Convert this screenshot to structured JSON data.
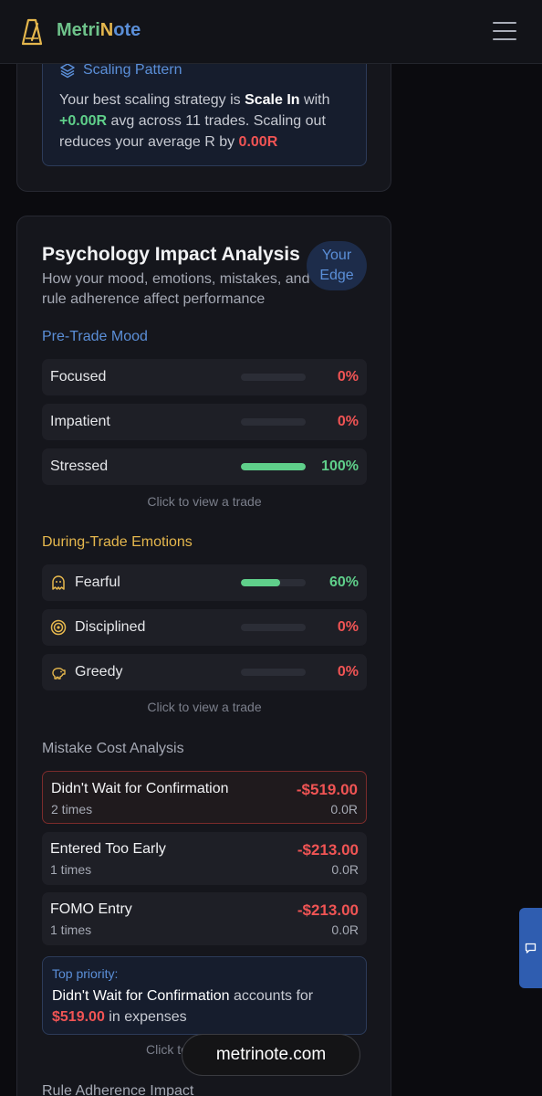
{
  "header": {
    "brand_part1": "Metri",
    "brand_part2": "N",
    "brand_part3": "ote",
    "logo_icon": "metronome-icon",
    "menu_icon": "hamburger-icon"
  },
  "scaling": {
    "title": "Scaling Pattern",
    "icon": "layers-icon",
    "text_1": "Your best scaling strategy is ",
    "strategy": "Scale In",
    "text_2": " with ",
    "avg_r": "+0.00R",
    "text_3": " avg across 11 trades. Scaling out reduces your average R by ",
    "reduce_r": "0.00R"
  },
  "psychology": {
    "title": "Psychology Impact Analysis",
    "subtitle": "How your mood, emotions, mistakes, and rule adherence affect performance",
    "badge": "Your Edge",
    "pre_trade_title": "Pre-Trade Mood",
    "moods": [
      {
        "label": "Focused",
        "pct": "0%",
        "value": 0
      },
      {
        "label": "Impatient",
        "pct": "0%",
        "value": 0
      },
      {
        "label": "Stressed",
        "pct": "100%",
        "value": 100
      }
    ],
    "hint": "Click to view a trade",
    "emotions_title": "During-Trade Emotions",
    "emotions": [
      {
        "label": "Fearful",
        "pct": "60%",
        "value": 60,
        "icon": "ghost-icon"
      },
      {
        "label": "Disciplined",
        "pct": "0%",
        "value": 0,
        "icon": "target-icon"
      },
      {
        "label": "Greedy",
        "pct": "0%",
        "value": 0,
        "icon": "piggy-bank-icon"
      }
    ],
    "mistakes_title": "Mistake Cost Analysis",
    "mistakes": [
      {
        "name": "Didn't Wait for Confirmation",
        "times": "2 times",
        "amount": "-$519.00",
        "r": "0.0R"
      },
      {
        "name": "Entered Too Early",
        "times": "1 times",
        "amount": "-$213.00",
        "r": "0.0R"
      },
      {
        "name": "FOMO Entry",
        "times": "1 times",
        "amount": "-$213.00",
        "r": "0.0R"
      }
    ],
    "priority_title": "Top priority:",
    "priority_name": "Didn't Wait for Confirmation",
    "priority_text": " accounts for ",
    "priority_amount": "$519.00",
    "priority_tail": " in expenses",
    "hint_partial": "Click to",
    "rule_title": "Rule Adherence Impact"
  },
  "footer": {
    "url": "metrinote.com",
    "feedback_icon": "chat-icon"
  },
  "colors": {
    "accent_blue": "#5b8fd8",
    "accent_green": "#5fcf8a",
    "accent_red": "#f05454",
    "accent_amber": "#e5b74d"
  }
}
